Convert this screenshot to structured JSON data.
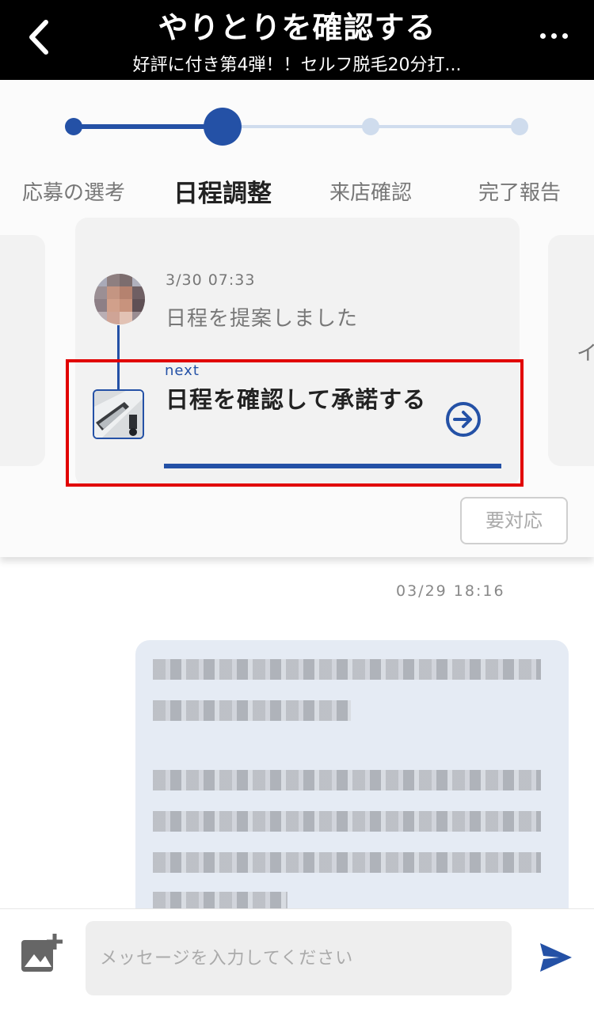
{
  "header": {
    "title": "やりとりを確認する",
    "subtitle": "好評に付き第4弾！！セルフ脱毛20分打..."
  },
  "steps": [
    {
      "label": "応募の選考",
      "state": "done"
    },
    {
      "label": "日程調整",
      "state": "current"
    },
    {
      "label": "来店確認",
      "state": "pending"
    },
    {
      "label": "完了報告",
      "state": "pending"
    }
  ],
  "card": {
    "timestamp": "3/30 07:33",
    "previous_action": "日程を提案しました",
    "next_label": "next",
    "next_action": "日程を確認して承諾する"
  },
  "side_card_text": "イ",
  "status_badge": "要対応",
  "chat": {
    "date": "03/29 18:16"
  },
  "input": {
    "placeholder": "メッセージを入力してください"
  },
  "colors": {
    "accent": "#2451a6",
    "highlight": "#e10000",
    "header_bg": "#000000",
    "bubble_bg": "#e5ebf4"
  }
}
